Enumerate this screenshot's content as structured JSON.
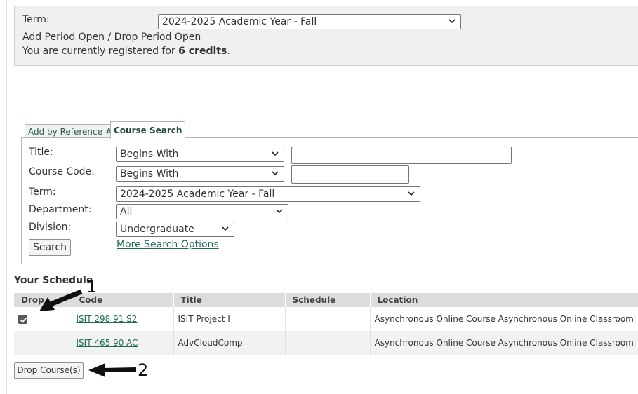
{
  "term_panel": {
    "label": "Term:",
    "selected": "2024-2025 Academic Year - Fall",
    "period_status": "Add Period Open / Drop Period Open",
    "registered_prefix": "You are currently registered for ",
    "registered_credits": "6 credits",
    "registered_suffix": "."
  },
  "tabs": [
    {
      "label": "Add by Reference #",
      "active": false
    },
    {
      "label": "Course Search",
      "active": true
    }
  ],
  "search": {
    "title_label": "Title:",
    "title_mode": "Begins With",
    "title_value": "",
    "code_label": "Course Code:",
    "code_mode": "Begins With",
    "code_value": "",
    "term_label": "Term:",
    "term_value": "2024-2025 Academic Year - Fall",
    "department_label": "Department:",
    "department_value": "All",
    "division_label": "Division:",
    "division_value": "Undergraduate",
    "search_button": "Search",
    "more_options": "More Search Options"
  },
  "schedule": {
    "title": "Your Schedule",
    "columns": [
      "Drop",
      "Code",
      "Title",
      "Schedule",
      "Location"
    ],
    "rows": [
      {
        "drop_checked": true,
        "code": "ISIT 298 91 S2",
        "title": "ISIT Project I",
        "schedule": "",
        "location": "Asynchronous Online Course  Asynchronous Online Classroom"
      },
      {
        "drop_checked": false,
        "code": "ISIT 465 90 AC",
        "title": "AdvCloudComp",
        "schedule": "",
        "location": "Asynchronous Online Course  Asynchronous Online Classroom"
      }
    ],
    "drop_button": "Drop Course(s)"
  },
  "annotations": {
    "marker1": "1",
    "marker2": "2"
  },
  "colors": {
    "link": "#1f6b56",
    "header_bg": "#dcdcdc",
    "panel_bg": "#f0f0f0"
  }
}
